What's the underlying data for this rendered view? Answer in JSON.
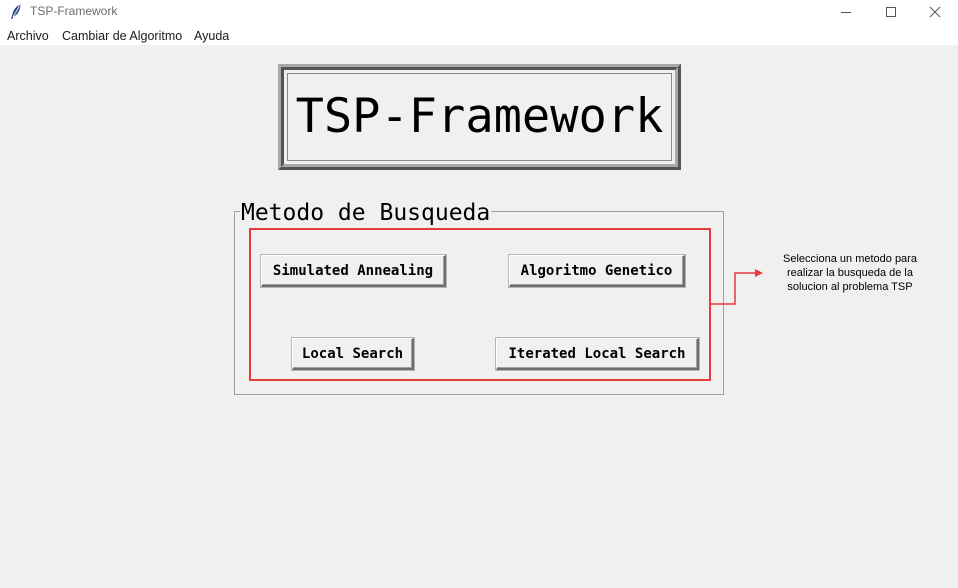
{
  "window": {
    "title": "TSP-Framework",
    "app_icon": "feather-icon",
    "controls": {
      "minimize": "minimize-icon",
      "maximize": "maximize-icon",
      "close": "close-icon"
    }
  },
  "menubar": {
    "items": [
      {
        "label": "Archivo"
      },
      {
        "label": "Cambiar de Algoritmo"
      },
      {
        "label": "Ayuda"
      }
    ]
  },
  "main": {
    "title": "TSP-Framework",
    "method_group": {
      "legend": "Metodo de Busqueda",
      "buttons": [
        {
          "label": "Simulated Annealing"
        },
        {
          "label": "Algoritmo Genetico"
        },
        {
          "label": "Local Search"
        },
        {
          "label": "Iterated Local Search"
        }
      ]
    },
    "annotation": {
      "lines": [
        "Selecciona un metodo para",
        "realizar la busqueda de la",
        "solucion al problema TSP"
      ],
      "color": "#e53b3b"
    }
  }
}
